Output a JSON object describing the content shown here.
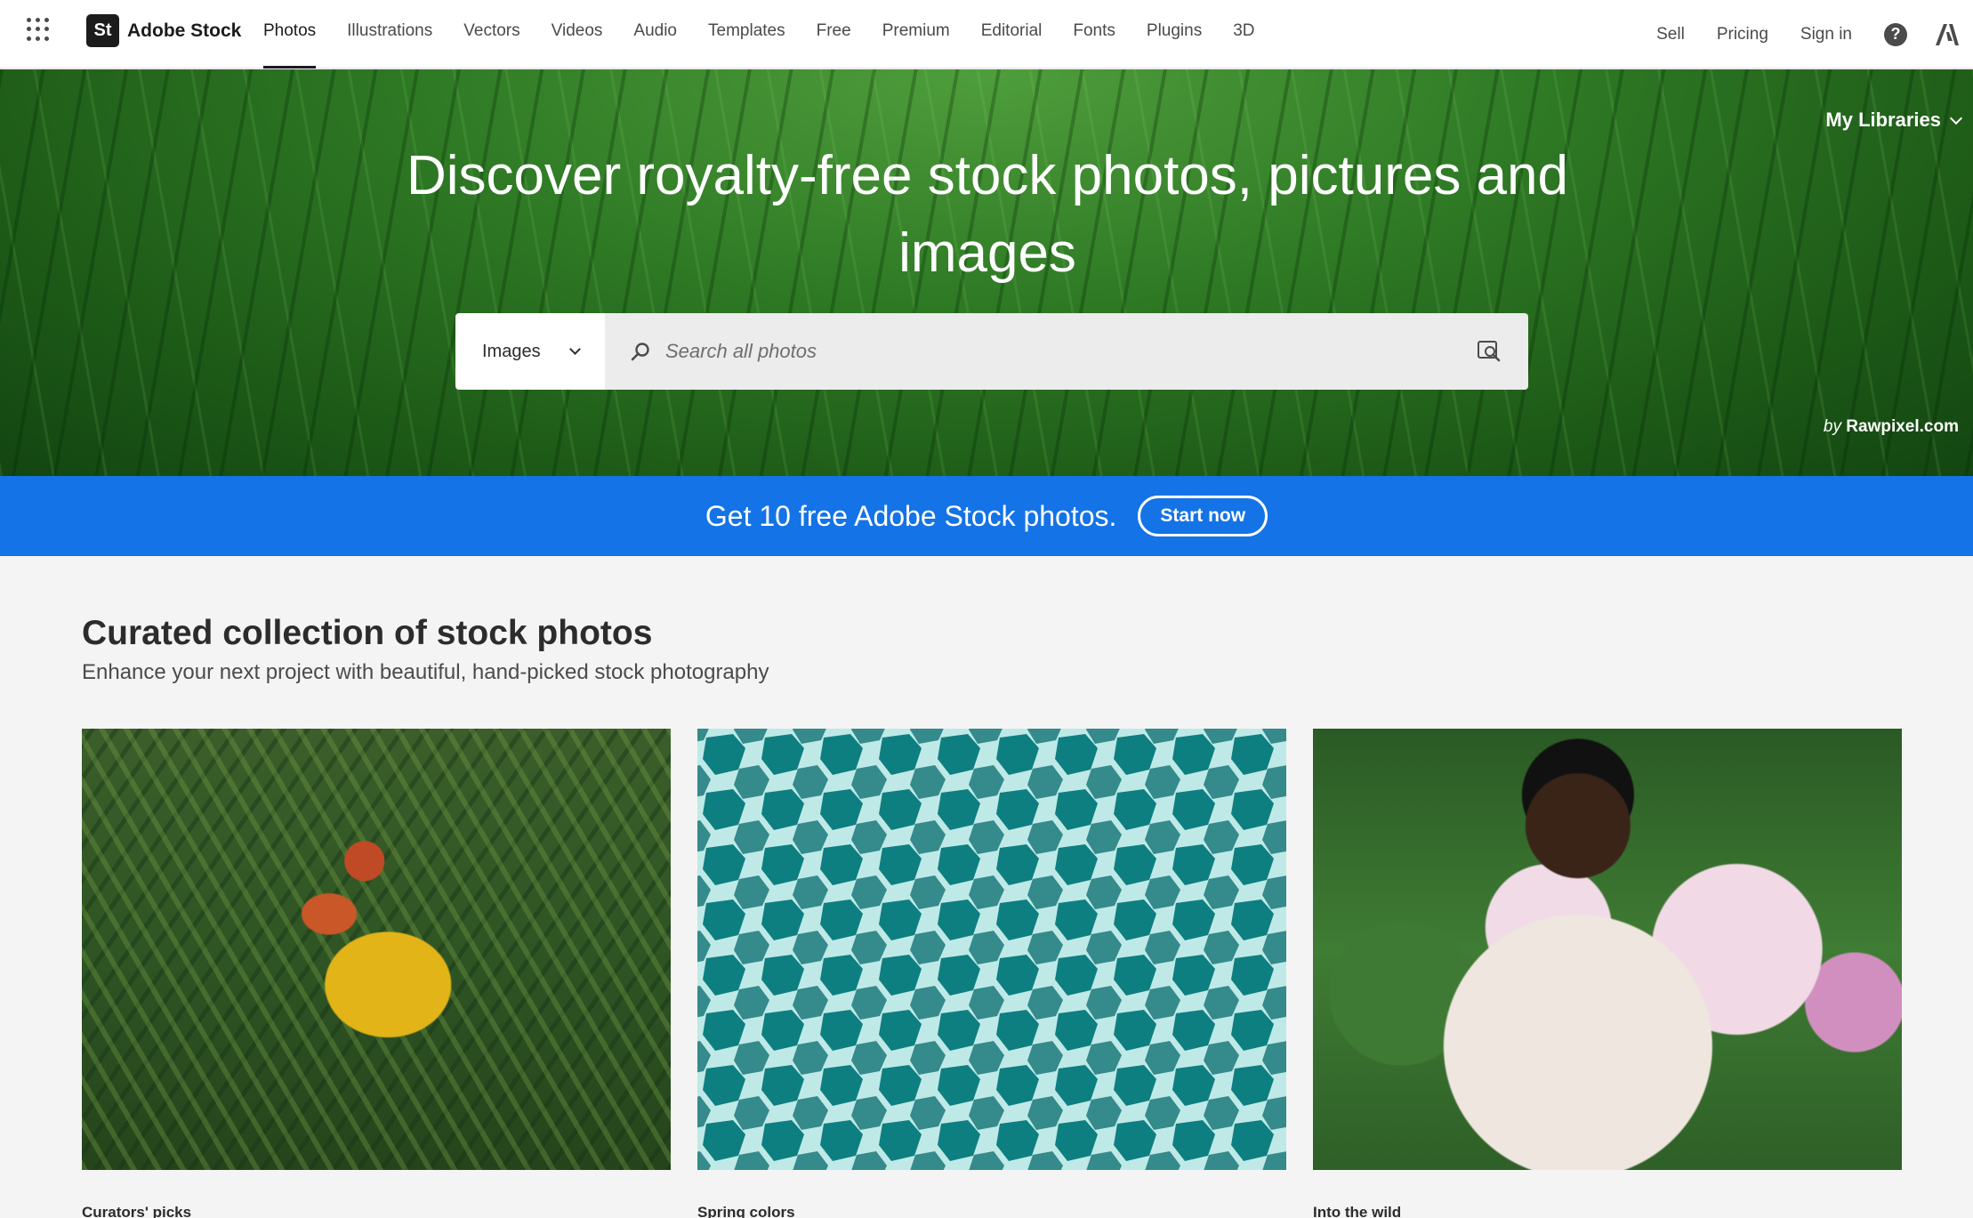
{
  "nav": {
    "logo_mark": "St",
    "logo_text": "Adobe Stock",
    "links": [
      "Photos",
      "Illustrations",
      "Vectors",
      "Videos",
      "Audio",
      "Templates",
      "Free",
      "Premium",
      "Editorial",
      "Fonts",
      "Plugins",
      "3D"
    ],
    "active_link": "Photos",
    "sell": "Sell",
    "pricing": "Pricing",
    "sign_in": "Sign in",
    "help_glyph": "?"
  },
  "hero": {
    "my_libraries": "My Libraries",
    "title": "Discover royalty-free stock photos, pictures and images",
    "search_type": "Images",
    "search_placeholder": "Search all photos",
    "credit_by": "by",
    "credit_name": "Rawpixel.com"
  },
  "promo": {
    "text": "Get 10 free Adobe Stock photos.",
    "button": "Start now"
  },
  "curated": {
    "title": "Curated collection of stock photos",
    "subtitle": "Enhance your next project with beautiful, hand-picked stock photography",
    "cards": [
      {
        "label": "Curators' picks"
      },
      {
        "label": "Spring colors"
      },
      {
        "label": "Into the wild"
      }
    ]
  },
  "colors": {
    "accent_blue": "#1473e6",
    "nav_text": "#4a4a4a",
    "hero_green": "#2f7a25"
  },
  "icons": [
    "app-switcher-icon",
    "chevron-down-icon",
    "search-icon",
    "visual-search-icon",
    "help-icon",
    "adobe-icon"
  ]
}
